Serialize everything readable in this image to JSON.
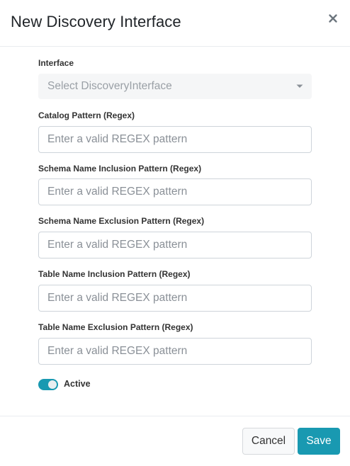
{
  "dialog": {
    "title": "New Discovery Interface",
    "close_icon": "close-icon"
  },
  "form": {
    "interface": {
      "label": "Interface",
      "selected": "Select DiscoveryInterface",
      "disabled": true
    },
    "catalog_pattern": {
      "label": "Catalog Pattern (Regex)",
      "placeholder": "Enter a valid REGEX pattern",
      "value": ""
    },
    "schema_inclusion": {
      "label": "Schema Name Inclusion Pattern (Regex)",
      "placeholder": "Enter a valid REGEX pattern",
      "value": ""
    },
    "schema_exclusion": {
      "label": "Schema Name Exclusion Pattern (Regex)",
      "placeholder": "Enter a valid REGEX pattern",
      "value": ""
    },
    "table_inclusion": {
      "label": "Table Name Inclusion Pattern (Regex)",
      "placeholder": "Enter a valid REGEX pattern",
      "value": ""
    },
    "table_exclusion": {
      "label": "Table Name Exclusion Pattern (Regex)",
      "placeholder": "Enter a valid REGEX pattern",
      "value": ""
    },
    "active": {
      "label": "Active",
      "on": true
    }
  },
  "footer": {
    "cancel_label": "Cancel",
    "save_label": "Save"
  },
  "colors": {
    "accent": "#1999b1",
    "border": "#ced4da",
    "disabled_bg": "#f5f6f7"
  }
}
